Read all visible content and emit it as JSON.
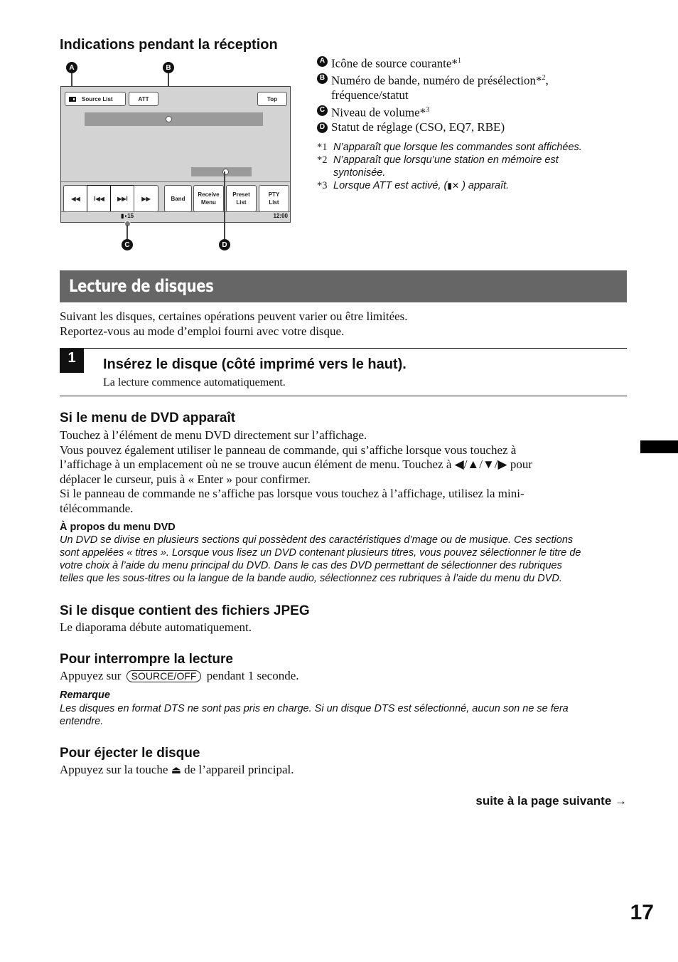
{
  "reception": {
    "heading": "Indications pendant la réception",
    "diagram": {
      "callouts": [
        "A",
        "B",
        "C",
        "D"
      ],
      "buttons": {
        "source_list": "Source List",
        "att": "ATT",
        "top": "Top",
        "rewind": "◀◀",
        "prev": "I◀◀",
        "next": "▶▶I",
        "forward": "▶▶",
        "band": "Band",
        "receive_menu_1": "Receive",
        "receive_menu_2": "Menu",
        "preset_list_1": "Preset",
        "preset_list_2": "List",
        "pty_list_1": "PTY",
        "pty_list_2": "List"
      },
      "volume_level": "15",
      "clock": "12:00",
      "source_icon": "radio-source-icon",
      "volume_icon": "speaker-icon"
    },
    "legend": [
      {
        "badge": "A",
        "text": "Icône de source courante*",
        "sup": "1"
      },
      {
        "badge": "B",
        "text": "Numéro de bande, numéro de présélection*",
        "sup": "2",
        "text_after": ",",
        "line2": "fréquence/statut"
      },
      {
        "badge": "C",
        "text": "Niveau de volume*",
        "sup": "3"
      },
      {
        "badge": "D",
        "text": "Statut de réglage (CSO, EQ7, RBE)"
      }
    ],
    "footnotes": [
      {
        "mark": "*1",
        "text": "N’apparaît que lorsque les commandes sont affichées."
      },
      {
        "mark": "*2",
        "text": "N’apparaît que lorsqu’une station en mémoire est",
        "line2": "syntonisée."
      },
      {
        "mark": "*3",
        "text_before": "Lorsque ATT est activé, (",
        "icon": "mute-speaker-icon",
        "text_after": " ) apparaît."
      }
    ]
  },
  "section": {
    "title": "Lecture de disques",
    "intro": [
      "Suivant les disques, certaines opérations peuvent varier ou être limitées.",
      "Reportez-vous au mode d’emploi fourni avec votre disque."
    ]
  },
  "step1": {
    "number": "1",
    "title": "Insérez le disque (côté imprimé vers le haut).",
    "text": "La lecture commence automatiquement."
  },
  "dvd_menu": {
    "heading": "Si le menu de DVD apparaît",
    "lines": [
      "Touchez à l’élément de menu DVD directement sur l’affichage.",
      "Vous pouvez également utiliser le panneau de commande, qui s’affiche lorsque vous touchez à",
      "l’affichage à un emplacement où ne se trouve aucun élément de menu. Touchez à ◀/▲/▼/▶ pour",
      "déplacer le curseur, puis à « Enter » pour confirmer.",
      "Si le panneau de commande ne s’affiche pas lorsque vous touchez à l’affichage, utilisez la mini-",
      "télécommande."
    ],
    "about_heading": "À propos du menu DVD",
    "about_lines": [
      "Un DVD se divise en plusieurs sections qui possèdent des caractéristiques d’mage ou de musique. Ces sections",
      "sont appelées « titres ». Lorsque vous lisez un DVD contenant plusieurs titres, vous pouvez sélectionner le titre de",
      "votre choix à l’aide du menu principal du DVD. Dans le cas des DVD permettant de sélectionner des rubriques",
      "telles que les sous-titres ou la langue de la bande audio, sélectionnez ces rubriques à l’aide du menu du DVD."
    ]
  },
  "jpeg": {
    "heading": "Si le disque contient des fichiers JPEG",
    "text": "Le diaporama débute automatiquement."
  },
  "stop": {
    "heading": "Pour interrompre la lecture",
    "text_before": "Appuyez sur",
    "key": "SOURCE/OFF",
    "text_after": "pendant 1 seconde.",
    "note_heading": "Remarque",
    "note_lines": [
      "Les disques en format DTS ne sont pas pris en charge. Si un disque DTS est sélectionné, aucun son ne se fera",
      "entendre."
    ]
  },
  "eject": {
    "heading": "Pour éjecter le disque",
    "text_before": "Appuyez sur la touche",
    "icon": "eject-icon",
    "text_after": "de l’appareil principal."
  },
  "continued": "suite à la page suivante →",
  "page_number": "17"
}
